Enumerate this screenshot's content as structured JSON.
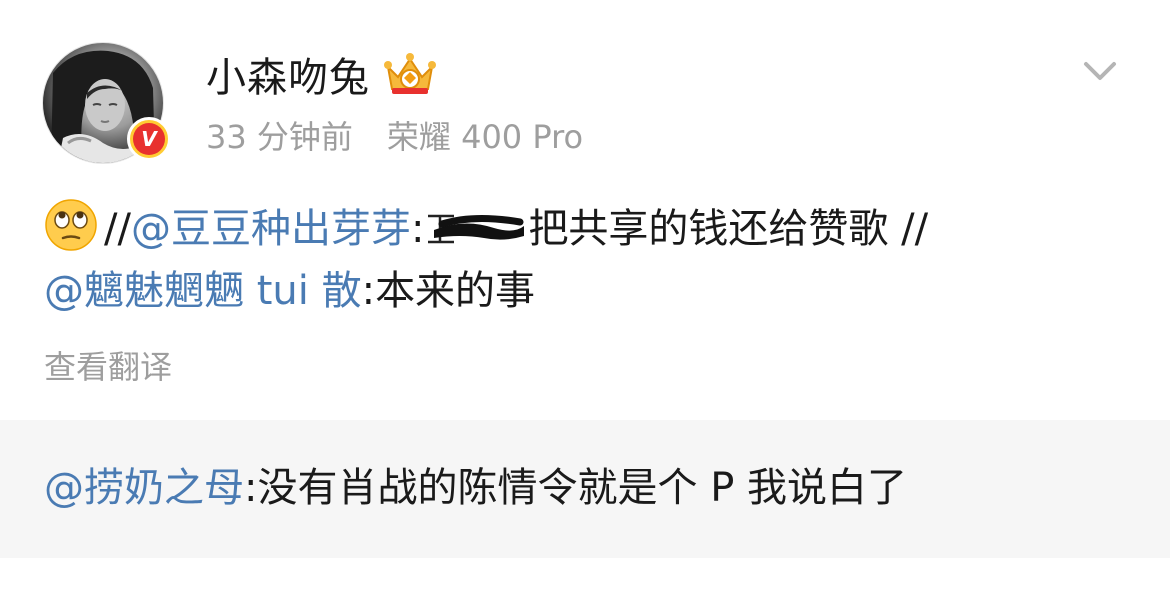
{
  "post": {
    "username": "小森吻兔",
    "time": "33 分钟前",
    "device": "荣耀 400 Pro",
    "content": {
      "emoji": "eye-roll-emoji",
      "sep1": "//",
      "mention1": "@豆豆种出芽芽",
      "colon1": ":",
      "text1": "把共享的钱还给赞歌",
      "sep2": " //",
      "mention2": "@魑魅魍魉 tui 散",
      "colon2": ":",
      "text2": "本来的事"
    },
    "translate_label": "查看翻译"
  },
  "quote": {
    "mention": "@捞奶之母",
    "colon": ":",
    "text": "没有肖战的陈情令就是个 P 我说白了"
  },
  "colors": {
    "mention": "#4a7bb3",
    "meta": "#9e9e9e",
    "quote_bg": "#f6f6f6",
    "verified_red": "#e8312e",
    "verified_gold": "#ffcc33"
  }
}
